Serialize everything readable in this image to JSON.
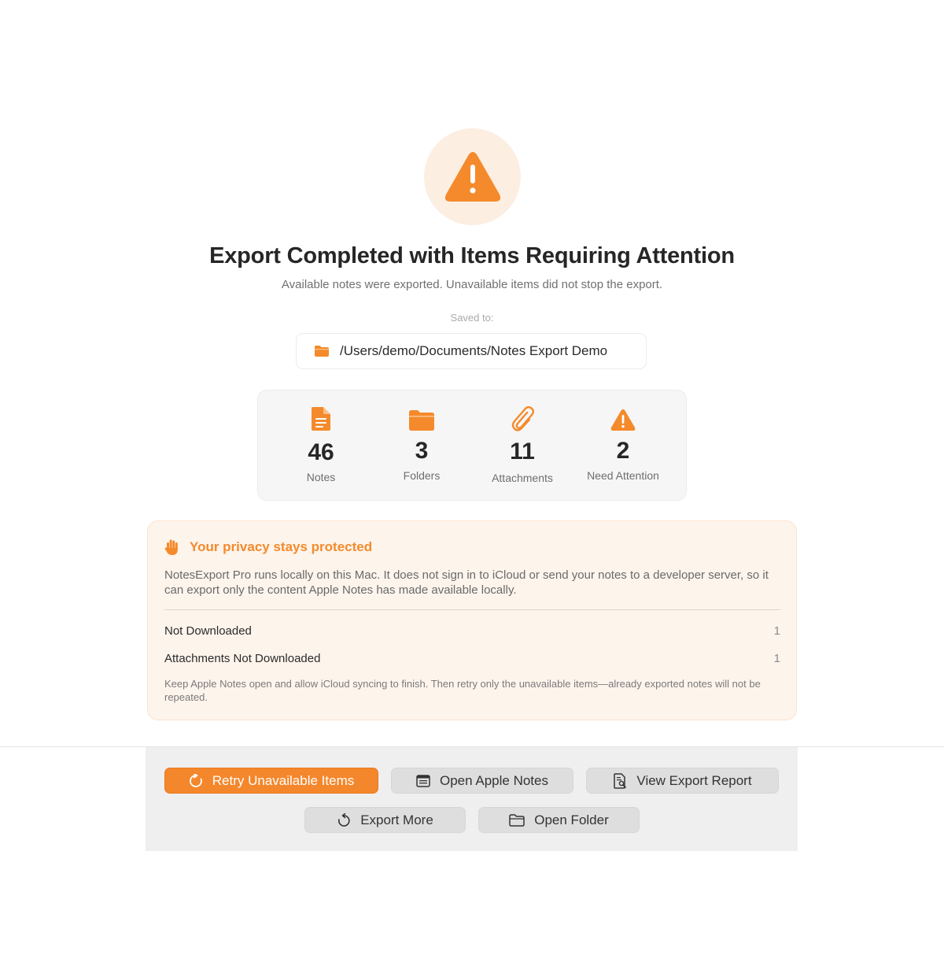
{
  "header": {
    "icon": "warning-triangle-icon",
    "title": "Export Completed with Items Requiring Attention",
    "subtitle": "Available notes were exported. Unavailable items did not stop the export."
  },
  "saved": {
    "label": "Saved to:",
    "path": "/Users/demo/Documents/Notes Export Demo",
    "icon": "folder-icon"
  },
  "stats": [
    {
      "icon": "note-document-icon",
      "value": "46",
      "label": "Notes"
    },
    {
      "icon": "folder-icon",
      "value": "3",
      "label": "Folders"
    },
    {
      "icon": "paperclip-icon",
      "value": "11",
      "label": "Attachments"
    },
    {
      "icon": "warning-triangle-icon",
      "value": "2",
      "label": "Need Attention"
    }
  ],
  "privacy": {
    "icon": "hand-icon",
    "title": "Your privacy stays protected",
    "body": "NotesExport Pro runs locally on this Mac. It does not sign in to iCloud or send your notes to a developer server, so it can export only the content Apple Notes has made available locally.",
    "issues": [
      {
        "label": "Not Downloaded",
        "count": "1"
      },
      {
        "label": "Attachments Not Downloaded",
        "count": "1"
      }
    ],
    "note": "Keep Apple Notes open and allow iCloud syncing to finish. Then retry only the unavailable items—already exported notes will not be repeated."
  },
  "actions": {
    "retry": "Retry Unavailable Items",
    "open_notes": "Open Apple Notes",
    "view_report": "View Export Report",
    "export_more": "Export More",
    "open_folder": "Open Folder"
  },
  "colors": {
    "accent": "#F4872C",
    "accent_light": "#FDEEE2",
    "privacy_bg": "#FDF4EC"
  }
}
